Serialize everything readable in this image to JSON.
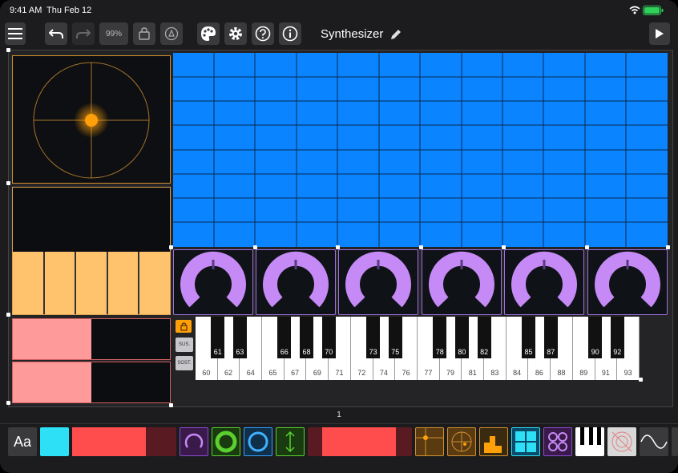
{
  "status_bar": {
    "time": "9:41 AM",
    "date": "Thu Feb 12"
  },
  "toolbar": {
    "zoom": "99%",
    "title": "Synthesizer"
  },
  "keyboard": {
    "white_labels": [
      "60",
      "62",
      "64",
      "65",
      "67",
      "69",
      "71",
      "72",
      "74",
      "76",
      "77",
      "79",
      "81",
      "83",
      "84",
      "86",
      "88",
      "89",
      "91",
      "93"
    ],
    "black_labels": [
      "61",
      "63",
      "66",
      "68",
      "70",
      "73",
      "75",
      "78",
      "80",
      "82",
      "85",
      "87",
      "90",
      "92"
    ],
    "lock_label": "",
    "sus_label": "SUS.",
    "sost_label": "SOST."
  },
  "page_indicator": "1",
  "dock": {
    "text_tool_label": "Aa"
  },
  "colors": {
    "grid_blue": "#0a84ff",
    "slider_yellow": "#ffc36e",
    "fader_pink": "#ff9a9a",
    "knob_purple": "#c58af5",
    "xy_orange": "#ff9f0a",
    "canvas_border": "#888888"
  },
  "icons": [
    "menu-icon",
    "undo-icon",
    "redo-icon",
    "lock-icon",
    "mic-icon",
    "palette-icon",
    "gear-icon",
    "help-icon",
    "info-icon",
    "pencil-icon",
    "play-icon",
    "wifi-icon",
    "battery-icon"
  ]
}
